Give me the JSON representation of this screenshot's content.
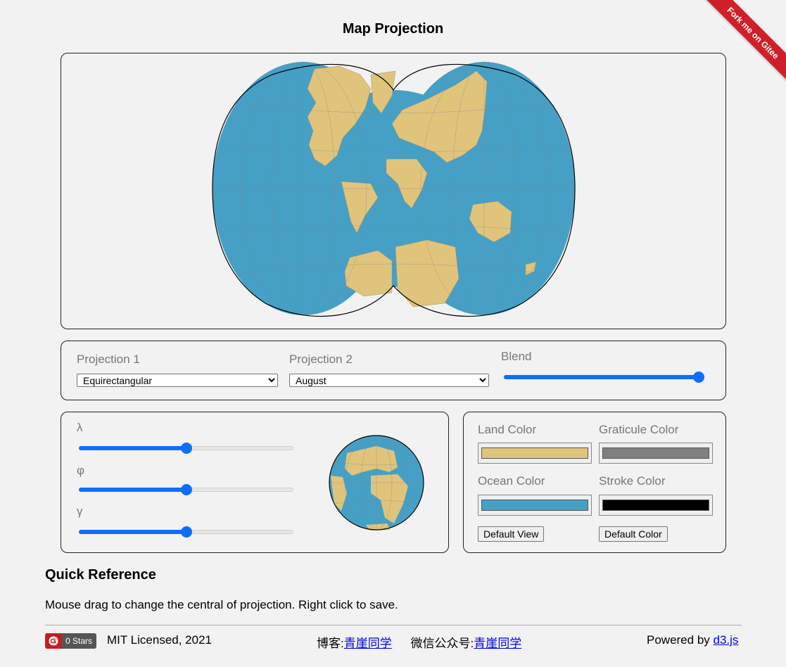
{
  "page": {
    "title": "Map Projection"
  },
  "ribbon": {
    "label": "Fork me on Gitee"
  },
  "projection": {
    "p1_label": "Projection 1",
    "p1_value": "Equirectangular",
    "p2_label": "Projection 2",
    "p2_value": "August",
    "blend_label": "Blend",
    "blend_value": 1.0
  },
  "rotation": {
    "lambda_label": "λ",
    "lambda_value": 0.5,
    "phi_label": "φ",
    "phi_value": 0.5,
    "gamma_label": "γ",
    "gamma_value": 0.5
  },
  "colors": {
    "land_label": "Land Color",
    "land": "#e0c47c",
    "graticule_label": "Graticule Color",
    "graticule": "#808080",
    "ocean_label": "Ocean Color",
    "ocean": "#46a0c6",
    "stroke_label": "Stroke Color",
    "stroke": "#000000",
    "default_view": "Default View",
    "default_color": "Default Color"
  },
  "reference": {
    "heading": "Quick Reference",
    "text": "Mouse drag to change the central of projection. Right click to save."
  },
  "footer": {
    "stars": "0 Stars",
    "license": "MIT Licensed, 2021",
    "blog_label": "博客:",
    "blog_link": "青崖同学",
    "wechat_label": "微信公众号:",
    "wechat_link": "青崖同学",
    "powered_label": "Powered by",
    "powered_link": "d3.js"
  },
  "accent": "#0d6efd"
}
